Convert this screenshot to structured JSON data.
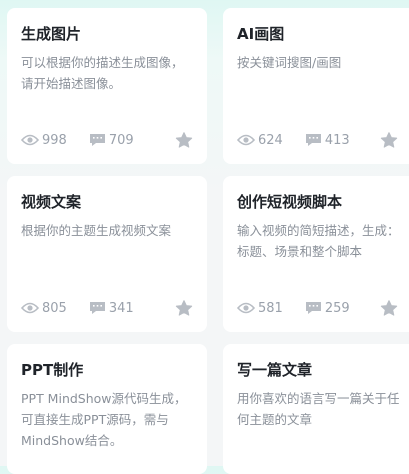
{
  "colors": {
    "icon": "#b8bdc4",
    "title": "#1f2329",
    "desc": "#8a9099",
    "stat": "#9aa1ab"
  },
  "cards": [
    {
      "title": "生成图片",
      "desc": "可以根据你的描述生成图像，请开始描述图像。",
      "views": "998",
      "comments": "709",
      "view_icon": "eye-icon",
      "comment_icon": "comment-icon",
      "star_icon": "star-icon"
    },
    {
      "title": "AI画图",
      "desc": "按关键词搜图/画图",
      "views": "624",
      "comments": "413",
      "view_icon": "eye-icon",
      "comment_icon": "comment-icon",
      "star_icon": "star-icon"
    },
    {
      "title": "视频文案",
      "desc": "根据你的主题生成视频文案",
      "views": "805",
      "comments": "341",
      "view_icon": "eye-icon",
      "comment_icon": "comment-icon",
      "star_icon": "star-icon"
    },
    {
      "title": "创作短视频脚本",
      "desc": "输入视频的简短描述，生成：标题、场景和整个脚本",
      "views": "581",
      "comments": "259",
      "view_icon": "eye-icon",
      "comment_icon": "comment-icon",
      "star_icon": "star-icon"
    },
    {
      "title": "PPT制作",
      "desc": "PPT MindShow源代码生成，可直接生成PPT源码，需与MindShow结合。"
    },
    {
      "title": "写一篇文章",
      "desc": "用你喜欢的语言写一篇关于任何主题的文章"
    }
  ]
}
